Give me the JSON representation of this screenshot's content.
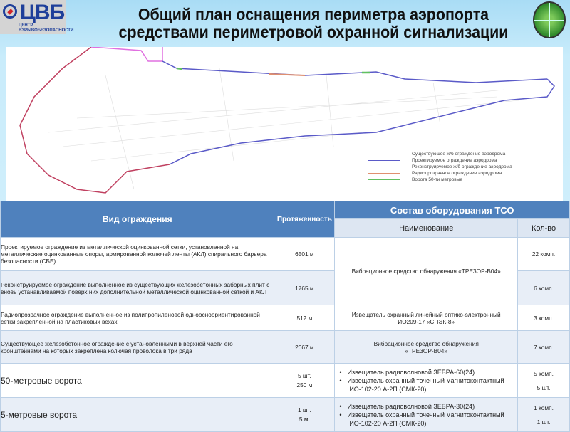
{
  "logo": {
    "abbr": "ЦВБ",
    "subtitle": "ЦЕНТР ВЗРЫВОБЕЗОПАСНОСТИ"
  },
  "title": "Общий план оснащения периметра аэропорта средствами периметровой охранной сигнализации",
  "colors": {
    "header": "#4f81bd",
    "existing": "#e070e0",
    "projected": "#5a5ac8",
    "reconstructed": "#c04060",
    "radio": "#e09070",
    "gates": "#60c060"
  },
  "legend": [
    {
      "label": "Существующее ж/б ограждение аэродрома",
      "color": "#e070e0"
    },
    {
      "label": "Проектируемое ограждение аэродрома",
      "color": "#5a5ac8"
    },
    {
      "label": "Реконструируемое ж/б ограждение аэродрома",
      "color": "#c04060"
    },
    {
      "label": "Радиопрозрачное ограждение аэродрома",
      "color": "#e09070"
    },
    {
      "label": "Ворота 50-ти метровые",
      "color": "#60c060"
    }
  ],
  "table": {
    "headers": {
      "type": "Вид ограждения",
      "length": "Протяженность",
      "equipment": "Состав оборудования ТСО",
      "name": "Наименование",
      "qty": "Кол-во"
    },
    "rows": [
      {
        "type": "Проектируемое ограждение из металлической оцинкованной сетки, установленной на металлические оцинкованные опоры, армированной колючей ленты (АКЛ) спирального барьера безопасности (СББ)",
        "length": "6501 м",
        "name": "Вибрационное средство обнаружения «ТРЕЗОР-В04»",
        "qty": "22 комп."
      },
      {
        "type": "Реконструируемое ограждение выполненное из существующих железобетонных заборных плит с вновь устанавливаемой поверх них дополнительной металлической оцинкованной сеткой и АКЛ",
        "length": "1765 м",
        "qty": "6 комп."
      },
      {
        "type": "Радиопрозрачное ограждение выполненное из полипропиленовой одноосноориентированной сетки закрепленной на пластиковых вехах",
        "length": "512 м",
        "name": "Извещатель охранный линейный оптико-электронный ИО209-17 «СПЭК-8»",
        "qty": "3 комп."
      },
      {
        "type": "Существующее железобетонное ограждение с установленными в верхней части его кронштейнами на которых закреплена колючая проволока в три ряда",
        "length": "2067 м",
        "name": "Вибрационное средство обнаружения «ТРЕЗОР-В04»",
        "qty": "7 комп."
      },
      {
        "type": "50-метровые ворота",
        "count": "5 шт.",
        "length": "250 м",
        "items": [
          "Извещатель радиоволновой ЗЕБРА-60(24)",
          "Извещатель охранный точечный магнитоконтактный ИО-102-20 А-2П (СМК-20)"
        ],
        "qty1": "5 комп.",
        "qty2": "5 шт."
      },
      {
        "type": "5-метровые ворота",
        "count": "1 шт.",
        "length": "5 м.",
        "items": [
          "Извещатель радиоволновой ЗЕБРА-30(24)",
          "Извещатель охранный точечный магнитоконтактный ИО-102-20 А-2П (СМК-20)"
        ],
        "qty1": "1 комп.",
        "qty2": "1 шт."
      }
    ]
  }
}
